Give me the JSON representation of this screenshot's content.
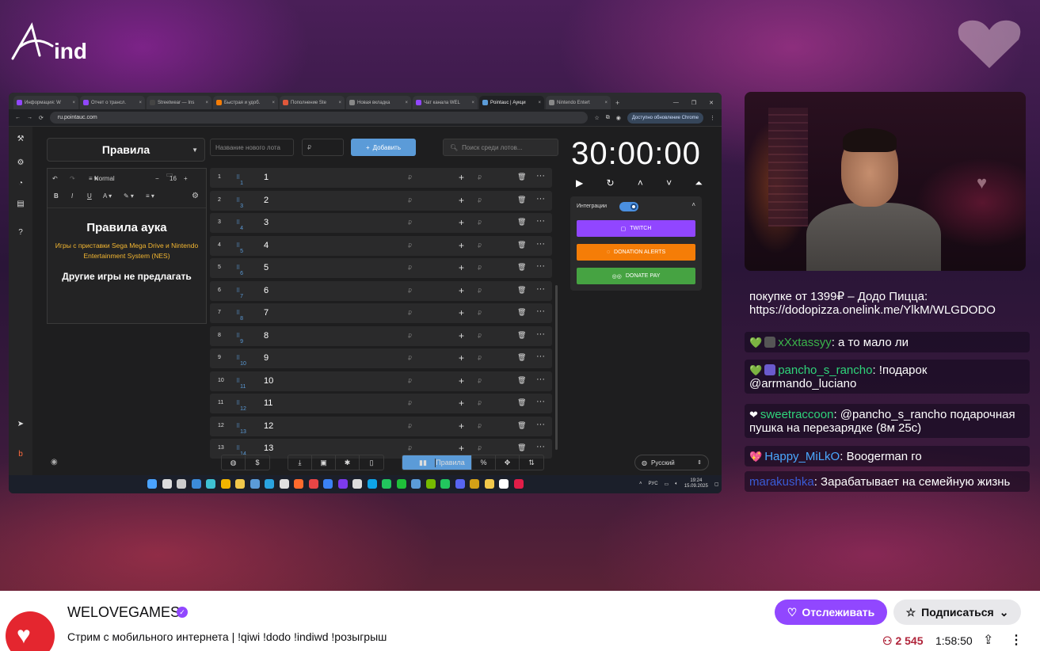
{
  "colors": {
    "accent": "#9147ff",
    "add_button": "#5b9bd8",
    "twitch": "#9146ff",
    "donation_alerts": "#f57d07",
    "donate_pay": "#46a342",
    "viewers": "#b0253b"
  },
  "overlay": {
    "logo_text": "ind"
  },
  "browser": {
    "tabs": [
      {
        "label": "Информация: W",
        "color": "#9147ff"
      },
      {
        "label": "Отчет о трансл.",
        "color": "#9147ff"
      },
      {
        "label": "Streetwear — Ins",
        "color": "#444444"
      },
      {
        "label": "Быстрая и удоб.",
        "color": "#f57d07"
      },
      {
        "label": "Пополнение Ste",
        "color": "#e0583b"
      },
      {
        "label": "Новая вкладка",
        "color": "#888888"
      },
      {
        "label": "Чат канала WEL",
        "color": "#9147ff"
      },
      {
        "label": "Pointauc | Аукци",
        "color": "#5b9bd8",
        "active": true
      },
      {
        "label": "Nintendo Entert",
        "color": "#888888"
      }
    ],
    "url": "ru.pointauc.com",
    "update_label": "Доступно обновление Chrome"
  },
  "app": {
    "rules_title": "Правила",
    "editor": {
      "font_label": "Normal",
      "font_size": "16",
      "heading": "Правила аука",
      "paragraph": "Игры с приставки Sega Mega Drive и Nintendo Entertainment System (NES)",
      "subheading": "Другие игры не предлагать"
    },
    "lot_name_placeholder": "Название нового лота",
    "price_placeholder": "₽",
    "add_label": "Добавить",
    "search_placeholder": "Поиск среди лотов...",
    "lots": [
      {
        "idx": "1",
        "num": "1",
        "name": "1",
        "rub": "₽"
      },
      {
        "idx": "2",
        "num": "3",
        "name": "2",
        "rub": "₽"
      },
      {
        "idx": "3",
        "num": "4",
        "name": "3",
        "rub": "₽"
      },
      {
        "idx": "4",
        "num": "5",
        "name": "4",
        "rub": "₽"
      },
      {
        "idx": "5",
        "num": "6",
        "name": "5",
        "rub": "₽"
      },
      {
        "idx": "6",
        "num": "7",
        "name": "6",
        "rub": "₽"
      },
      {
        "idx": "7",
        "num": "8",
        "name": "7",
        "rub": "₽"
      },
      {
        "idx": "8",
        "num": "9",
        "name": "8",
        "rub": "₽"
      },
      {
        "idx": "9",
        "num": "10",
        "name": "9",
        "rub": "₽"
      },
      {
        "idx": "10",
        "num": "11",
        "name": "10",
        "rub": "₽"
      },
      {
        "idx": "11",
        "num": "12",
        "name": "11",
        "rub": "₽"
      },
      {
        "idx": "12",
        "num": "13",
        "name": "12",
        "rub": "₽"
      },
      {
        "idx": "13",
        "num": "14",
        "name": "13",
        "rub": "₽"
      }
    ],
    "timer": "30:00:00",
    "integrations_label": "Интеграции",
    "twitch_label": "TWITCH",
    "donation_alerts_label": "DONATION ALERTS",
    "donate_pay_label": "DONATE PAY",
    "bottom_active_label": "Правила",
    "language": "Русский"
  },
  "taskbar": {
    "lang": "РУС",
    "time": "19:24",
    "date": "15.09.2025"
  },
  "chat": [
    {
      "text": "покупке от 1399₽ – Додо Пицца: https://dodopizza.onelink.me/YlkM/WLGDODO"
    },
    {
      "heart": "💚",
      "user": "xXxtassyy",
      "user_color": "#3bb34a",
      "text": ": а то мало ли"
    },
    {
      "heart": "💚",
      "user": "pancho_s_rancho",
      "user_color": "#2fd47a",
      "text": ": !подарок @arrmando_luciano"
    },
    {
      "heart": "❤",
      "user": "sweetraccoon",
      "user_color": "#2fd47a",
      "text": ": @pancho_s_rancho подарочная пушка на перезарядке (8м 25с)"
    },
    {
      "heart": "💖",
      "user": "Happy_MiLkO",
      "user_color": "#4aa8ff",
      "text": ": Boogerman го"
    },
    {
      "user": "marakushka",
      "user_color": "#3a5bd6",
      "text": ": Зарабатывает на семейную жизнь"
    }
  ],
  "channel": {
    "name": "WELOVEGAMES",
    "title": "Стрим с мобильного интернета | !qiwi !dodo !indiwd !розыгрыш",
    "follow_label": "Отслеживать",
    "subscribe_label": "Подписаться",
    "viewers": "2 545",
    "uptime": "1:58:50"
  }
}
